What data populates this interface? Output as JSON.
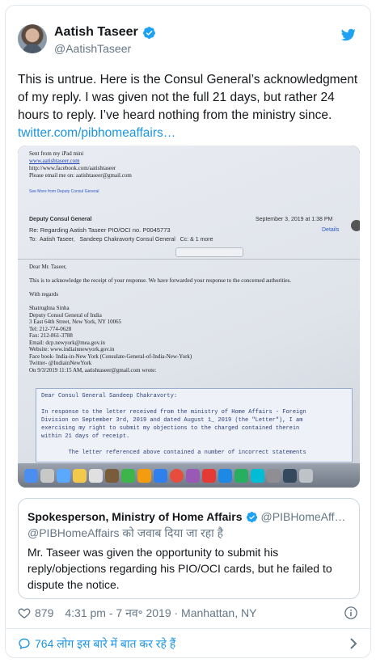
{
  "tweet": {
    "author": {
      "display_name": "Aatish Taseer",
      "handle": "@AatishTaseer"
    },
    "text": "This is untrue. Here is the Consul General’s acknowledgment of my reply. I was given not the full 21 days, but rather 24 hours to reply. I’ve heard nothing from the ministry since. ",
    "link_text": "twitter.com/pibhomeaffairs…",
    "photo": {
      "header_lines": [
        "Sent from my iPad mini",
        "www.aatishtaseer.com",
        "http://www.facebook.com/aatishtaseer",
        "Please email me on: aatishtaseer@gmail.com"
      ],
      "see_more": "See More from Deputy Consul General",
      "sender": "Deputy Consul General",
      "subject": "Re: Regarding Aatish Taseer PIO/OCI no. P0045773",
      "to_line": "To:  Aatish Taseer,   Sandeep Chakravorty Consul General   Cc: & 1 more",
      "date": "September 3, 2019 at 1:38 PM",
      "details": "Details",
      "body_lines": [
        "Dear Mr. Taseer,",
        "",
        "This is to acknowledge the receipt of your response. We have forwarded your response to the concerned authorities.",
        "",
        "With regards",
        "",
        "Shatrughna Sinha",
        "Deputy Consul General of India",
        "3 East 64th Street, New York, NY 10065",
        "Tel: 212-774-0628",
        "Fax: 212-861-3788",
        "Email: dcp.newyork@mea.gov.in",
        "Website: www.indiainnewyork.gov.in",
        "Face book- India-in-New York (Consulate-General-of-India-New-York)",
        "Twitter- @IndiainNewYork",
        "On 9/3/2019 11:15 AM, aatishtaseer@gmail.com wrote:"
      ],
      "quote_lines": [
        "Dear Consul General Sandeep Chakravorty:",
        "",
        "In response to the letter received from the ministry of Home Affairs - Foreign",
        "Division on September 3rd, 2019 and dated August 1_ 2019 (the \"Letter\"), I am",
        "exercising my right to submit my objections to the charged contained therein",
        "within 21 days of receipt.",
        "",
        "        The letter referenced above contained a number of incorrect statements"
      ]
    },
    "quoted_tweet": {
      "display_name": "Spokesperson, Ministry of Home Affairs",
      "handle": "@PIBHomeAff…",
      "reply_note": "@PIBHomeAffairs को जवाब दिया जा रहा है",
      "text": "Mr. Taseer was given the opportunity to submit his reply/objections regarding his PIO/OCI cards, but he failed to dispute the notice."
    },
    "likes": "879",
    "timestamp": "4:31 pm - 7 नव॰ 2019 · Manhattan, NY",
    "conversation_text": "764 लोग इस बारे में बात कर रहे हैं"
  },
  "colors": {
    "link": "#1b95e0",
    "text": "#14171a",
    "secondary": "#657786",
    "border": "#e1e8ed",
    "verified": "#1da1f2"
  },
  "icons": [
    "verified-badge-icon",
    "twitter-bird-icon",
    "heart-icon",
    "info-icon",
    "speech-bubble-icon",
    "chevron-right-icon"
  ]
}
